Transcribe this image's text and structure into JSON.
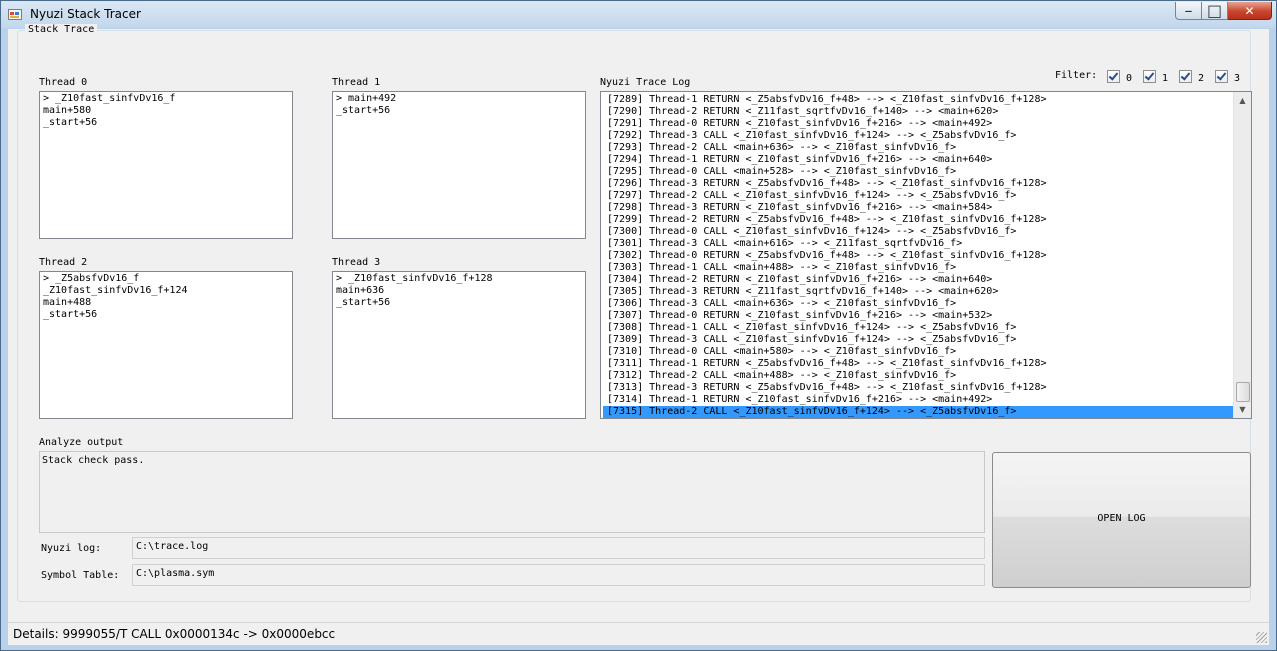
{
  "window": {
    "title": "Nyuzi Stack Tracer",
    "controls": {
      "minimize": "–",
      "maximize": "□",
      "close": "✕"
    }
  },
  "group": {
    "title": "Stack Trace"
  },
  "threads": [
    {
      "label": "Thread 0",
      "frames": [
        "> _Z10fast_sinfvDv16_f",
        "main+580",
        "_start+56"
      ]
    },
    {
      "label": "Thread 1",
      "frames": [
        "> main+492",
        "_start+56"
      ]
    },
    {
      "label": "Thread 2",
      "frames": [
        "> _Z5absfvDv16_f",
        "_Z10fast_sinfvDv16_f+124",
        "main+488",
        "_start+56"
      ]
    },
    {
      "label": "Thread 3",
      "frames": [
        "> _Z10fast_sinfvDv16_f+128",
        "main+636",
        "_start+56"
      ]
    }
  ],
  "trace_log": {
    "label": "Nyuzi Trace Log",
    "selected_index": 26,
    "lines": [
      "[7289] Thread-1 RETURN <_Z5absfvDv16_f+48> --> <_Z10fast_sinfvDv16_f+128>",
      "[7290] Thread-2 RETURN <_Z11fast_sqrtfvDv16_f+140> --> <main+620>",
      "[7291] Thread-0 RETURN <_Z10fast_sinfvDv16_f+216> --> <main+492>",
      "[7292] Thread-3 CALL <_Z10fast_sinfvDv16_f+124> --> <_Z5absfvDv16_f>",
      "[7293] Thread-2 CALL <main+636> --> <_Z10fast_sinfvDv16_f>",
      "[7294] Thread-1 RETURN <_Z10fast_sinfvDv16_f+216> --> <main+640>",
      "[7295] Thread-0 CALL <main+528> --> <_Z10fast_sinfvDv16_f>",
      "[7296] Thread-3 RETURN <_Z5absfvDv16_f+48> --> <_Z10fast_sinfvDv16_f+128>",
      "[7297] Thread-2 CALL <_Z10fast_sinfvDv16_f+124> --> <_Z5absfvDv16_f>",
      "[7298] Thread-3 RETURN <_Z10fast_sinfvDv16_f+216> --> <main+584>",
      "[7299] Thread-2 RETURN <_Z5absfvDv16_f+48> --> <_Z10fast_sinfvDv16_f+128>",
      "[7300] Thread-0 CALL <_Z10fast_sinfvDv16_f+124> --> <_Z5absfvDv16_f>",
      "[7301] Thread-3 CALL <main+616> --> <_Z11fast_sqrtfvDv16_f>",
      "[7302] Thread-0 RETURN <_Z5absfvDv16_f+48> --> <_Z10fast_sinfvDv16_f+128>",
      "[7303] Thread-1 CALL <main+488> --> <_Z10fast_sinfvDv16_f>",
      "[7304] Thread-2 RETURN <_Z10fast_sinfvDv16_f+216> --> <main+640>",
      "[7305] Thread-3 RETURN <_Z11fast_sqrtfvDv16_f+140> --> <main+620>",
      "[7306] Thread-3 CALL <main+636> --> <_Z10fast_sinfvDv16_f>",
      "[7307] Thread-0 RETURN <_Z10fast_sinfvDv16_f+216> --> <main+532>",
      "[7308] Thread-1 CALL <_Z10fast_sinfvDv16_f+124> --> <_Z5absfvDv16_f>",
      "[7309] Thread-3 CALL <_Z10fast_sinfvDv16_f+124> --> <_Z5absfvDv16_f>",
      "[7310] Thread-0 CALL <main+580> --> <_Z10fast_sinfvDv16_f>",
      "[7311] Thread-1 RETURN <_Z5absfvDv16_f+48> --> <_Z10fast_sinfvDv16_f+128>",
      "[7312] Thread-2 CALL <main+488> --> <_Z10fast_sinfvDv16_f>",
      "[7313] Thread-3 RETURN <_Z5absfvDv16_f+48> --> <_Z10fast_sinfvDv16_f+128>",
      "[7314] Thread-1 RETURN <_Z10fast_sinfvDv16_f+216> --> <main+492>",
      "[7315] Thread-2 CALL <_Z10fast_sinfvDv16_f+124> --> <_Z5absfvDv16_f>"
    ]
  },
  "filter": {
    "label": "Filter:",
    "options": [
      {
        "label": "0",
        "checked": true
      },
      {
        "label": "1",
        "checked": true
      },
      {
        "label": "2",
        "checked": true
      },
      {
        "label": "3",
        "checked": true
      }
    ]
  },
  "analyze": {
    "label": "Analyze output",
    "text": "Stack check pass."
  },
  "nyuzi_log": {
    "label": "Nyuzi log:",
    "value": "C:\\trace.log"
  },
  "symbol_table": {
    "label": "Symbol Table:",
    "value": "C:\\plasma.sym"
  },
  "open_log_button": {
    "label": "OPEN LOG"
  },
  "status": {
    "text": "Details:  9999055/T CALL 0x0000134c -> 0x0000ebcc"
  }
}
